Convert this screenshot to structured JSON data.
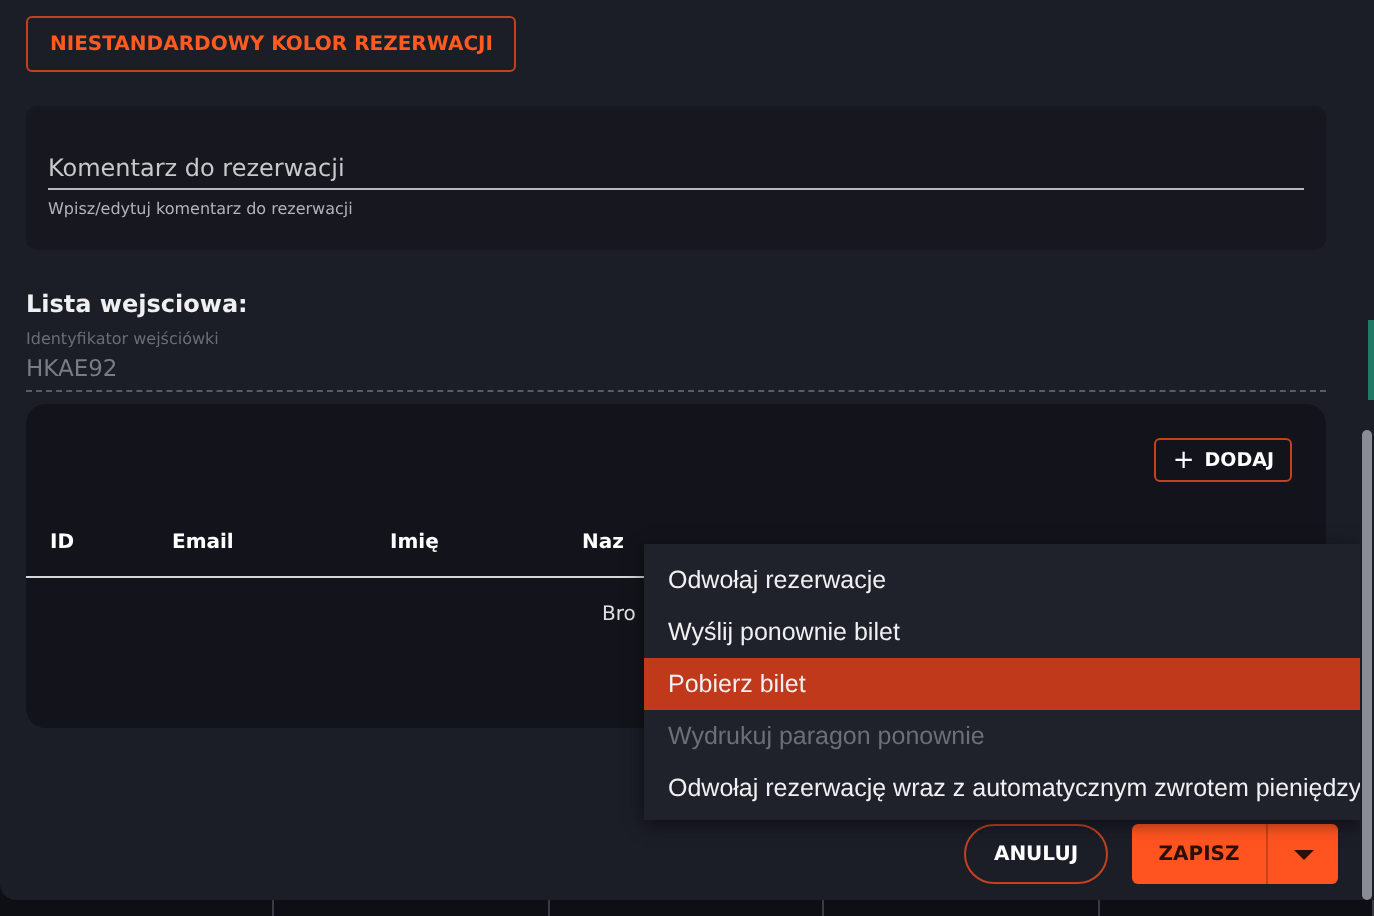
{
  "color_button": {
    "label": "NIESTANDARDOWY KOLOR REZERWACJI"
  },
  "comment": {
    "label": "Komentarz do rezerwacji",
    "helper": "Wpisz/edytuj komentarz do rezerwacji"
  },
  "entry_list": {
    "title": "Lista wejsciowa:",
    "id_field": {
      "label": "Identyfikator wejściówki",
      "value": "HKAE92"
    },
    "add_button": {
      "icon": "+",
      "label": "DODAJ"
    },
    "columns": [
      "ID",
      "Email",
      "Imię",
      "Naz"
    ],
    "empty_text": "Bro"
  },
  "menu": {
    "items": [
      {
        "label": "Odwołaj rezerwacje",
        "selected": false,
        "disabled": false
      },
      {
        "label": "Wyślij ponownie bilet",
        "selected": false,
        "disabled": false
      },
      {
        "label": "Pobierz bilet",
        "selected": true,
        "disabled": false
      },
      {
        "label": "Wydrukuj paragon ponownie",
        "selected": false,
        "disabled": true
      },
      {
        "label": "Odwołaj rezerwację wraz z automatycznym zwrotem pieniędzy",
        "selected": false,
        "disabled": false
      }
    ]
  },
  "footer": {
    "cancel": "ANULUJ",
    "save": "ZAPISZ"
  }
}
